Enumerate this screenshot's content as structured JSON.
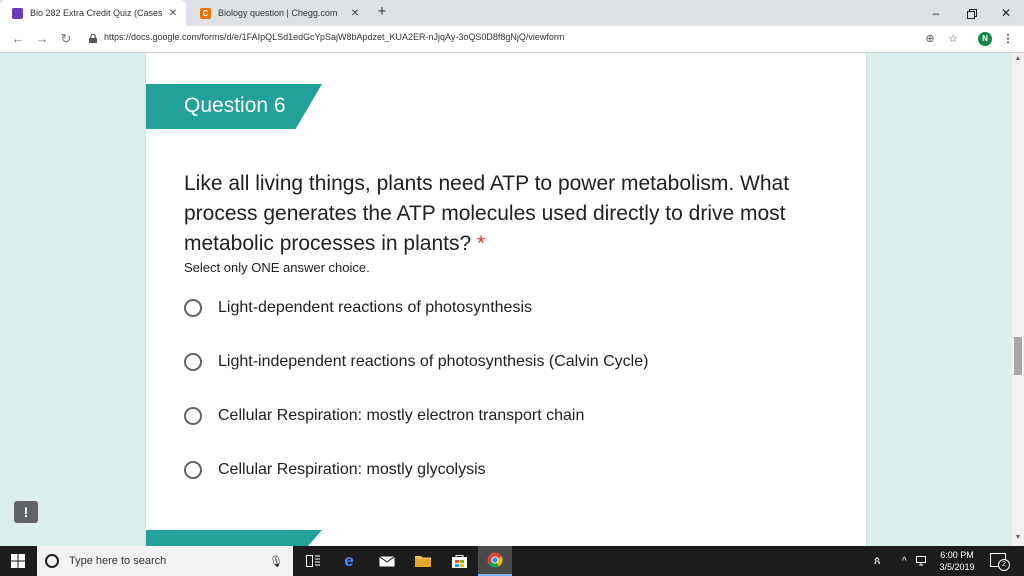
{
  "browser": {
    "tabs": [
      {
        "title": "Bio 282 Extra Credit Quiz (Cases",
        "favicon_color": "#673ab7",
        "active": true
      },
      {
        "title": "Biology question | Chegg.com",
        "favicon_color": "#eb7100",
        "favicon_letter": "C",
        "active": false
      }
    ],
    "new_tab": "+",
    "url": "https://docs.google.com/forms/d/e/1FAIpQLSd1edGcYpSajW8bApdzet_KUA2ER-nJjqAy-3oQS0D8f8gNjQ/viewform",
    "profile_initial": "N"
  },
  "form": {
    "question_header": "Question 6",
    "question_text": "Like all living things, plants need ATP to power metabolism. What process generates the ATP molecules used directly to drive most metabolic processes in plants?",
    "required_marker": "*",
    "help_text": "Select only ONE answer choice.",
    "options": [
      "Light-dependent reactions of photosynthesis",
      "Light-independent reactions of photosynthesis (Calvin Cycle)",
      "Cellular Respiration: mostly electron transport chain",
      "Cellular Respiration: mostly glycolysis"
    ],
    "accent_color": "#21a19a",
    "background_color": "#dcefef"
  },
  "feedback_button": "!",
  "taskbar": {
    "search_placeholder": "Type here to search",
    "time": "6:00 PM",
    "date": "3/5/2019",
    "notification_count": "2"
  }
}
